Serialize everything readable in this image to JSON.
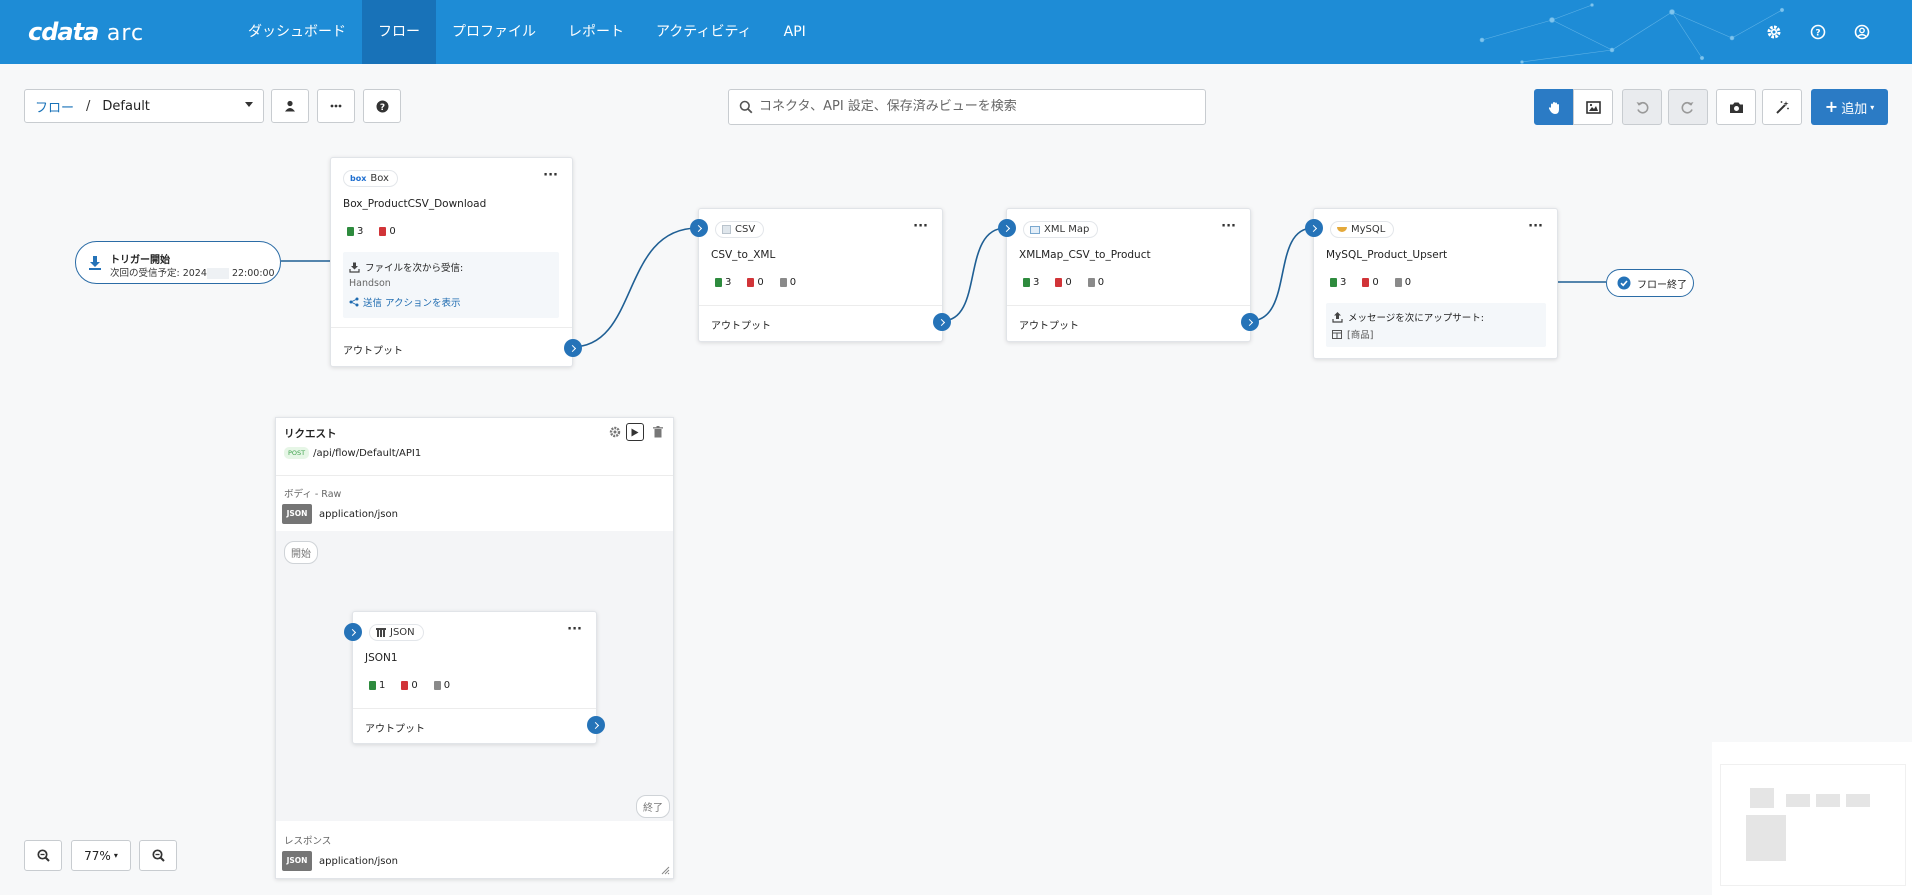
{
  "app": {
    "logo_main": "cdata",
    "logo_sub": "arc"
  },
  "nav": {
    "items": [
      {
        "label": "ダッシュボード"
      },
      {
        "label": "フロー"
      },
      {
        "label": "プロファイル"
      },
      {
        "label": "レポート"
      },
      {
        "label": "アクティビティ"
      },
      {
        "label": "API"
      }
    ],
    "active": "フロー"
  },
  "toolbar": {
    "breadcrumb_root": "フロー",
    "breadcrumb_sep": "/",
    "breadcrumb_current": "Default",
    "search_placeholder": "コネクタ、API 設定、保存済みビューを検索",
    "add_label": "追加"
  },
  "trigger": {
    "title": "トリガー開始",
    "schedule_prefix": "次回の受信予定: 2024",
    "schedule_time": "22:00:00"
  },
  "nodes": {
    "box": {
      "type": "Box",
      "name": "Box_ProductCSV_Download",
      "counts": {
        "success": "3",
        "error": "0"
      },
      "info_title": "ファイルを次から受信:",
      "info_value": "Handson",
      "info_link": "送信 アクションを表示",
      "output": "アウトプット"
    },
    "csv": {
      "type": "CSV",
      "name": "CSV_to_XML",
      "counts": {
        "success": "3",
        "error": "0",
        "other": "0"
      },
      "output": "アウトプット"
    },
    "xmlmap": {
      "type": "XML Map",
      "name": "XMLMap_CSV_to_Product",
      "counts": {
        "success": "3",
        "error": "0",
        "other": "0"
      },
      "output": "アウトプット"
    },
    "mysql": {
      "type": "MySQL",
      "name": "MySQL_Product_Upsert",
      "counts": {
        "success": "3",
        "error": "0",
        "other": "0"
      },
      "info_title": "メッセージを次にアップサート:",
      "info_value": "[商品]"
    }
  },
  "flow_end": "フロー終了",
  "request": {
    "title": "リクエスト",
    "method": "POST",
    "path": "/api/flow/Default/API1",
    "body_label": "ボディ - Raw",
    "body_tag": "JSON",
    "body_type": "application/json",
    "start_label": "開始",
    "end_label": "終了",
    "json_node": {
      "type": "JSON",
      "name": "JSON1",
      "counts": {
        "success": "1",
        "error": "0",
        "other": "0"
      },
      "output": "アウトプット"
    },
    "response_label": "レスポンス",
    "response_tag": "JSON",
    "response_type": "application/json"
  },
  "zoom": {
    "level": "77%"
  },
  "colors": {
    "header": "#1e8cd6",
    "accent": "#2573b8",
    "success": "#2e8b3e",
    "error": "#d13438"
  }
}
